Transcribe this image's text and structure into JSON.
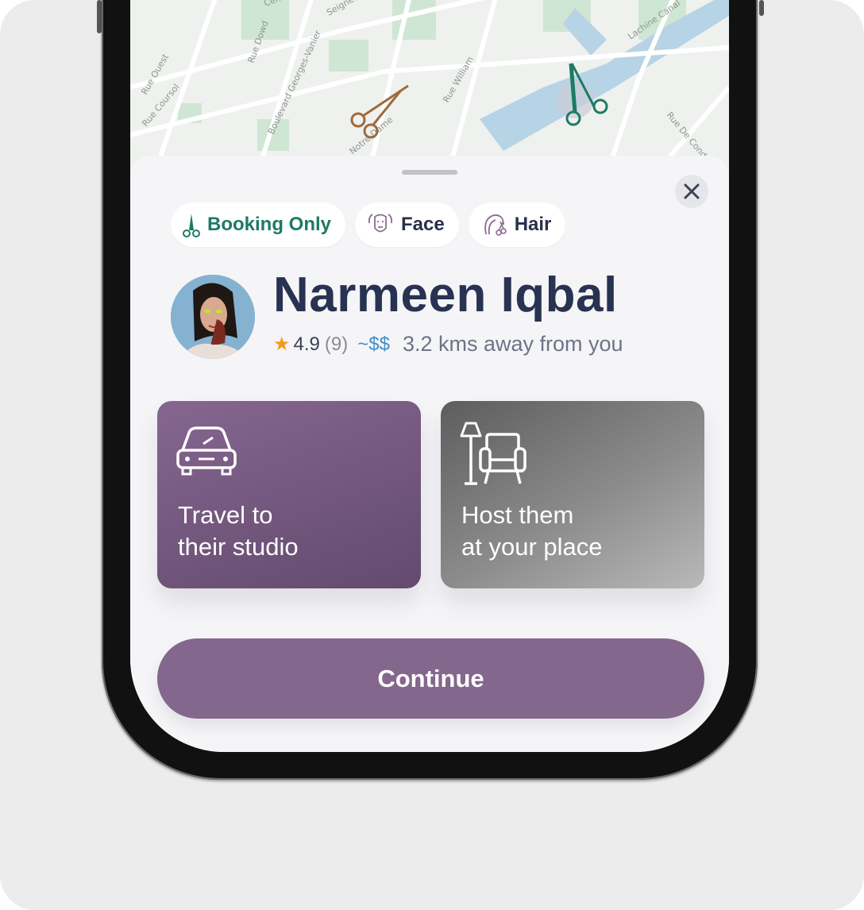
{
  "map": {
    "street_labels": [
      "Centre",
      "Seigneurs",
      "Rue Dowd",
      "Rue Ouest",
      "Rue Coursol",
      "Boulevard Georges-Vanier",
      "Notre-Dame",
      "Rue William",
      "Lachine Canal",
      "Rue De Condé"
    ]
  },
  "chips": [
    {
      "icon": "booking-only-icon",
      "label": "Booking Only"
    },
    {
      "icon": "face-icon",
      "label": "Face"
    },
    {
      "icon": "hair-icon",
      "label": "Hair"
    }
  ],
  "profile": {
    "name": "Narmeen Iqbal",
    "rating": "4.9",
    "review_count": "(9)",
    "price": "~$$",
    "distance": "3.2 kms away from you"
  },
  "options": [
    {
      "icon": "car-icon",
      "label": "Travel to\ntheir studio"
    },
    {
      "icon": "armchair-lamp-icon",
      "label": "Host them\nat your place"
    }
  ],
  "continue_label": "Continue",
  "colors": {
    "brand_purple": "#84678c",
    "accent_teal": "#1e7a64",
    "scissors_brown": "#a06a3c",
    "price_blue": "#3f8fc5",
    "star_orange": "#f39a1c"
  }
}
